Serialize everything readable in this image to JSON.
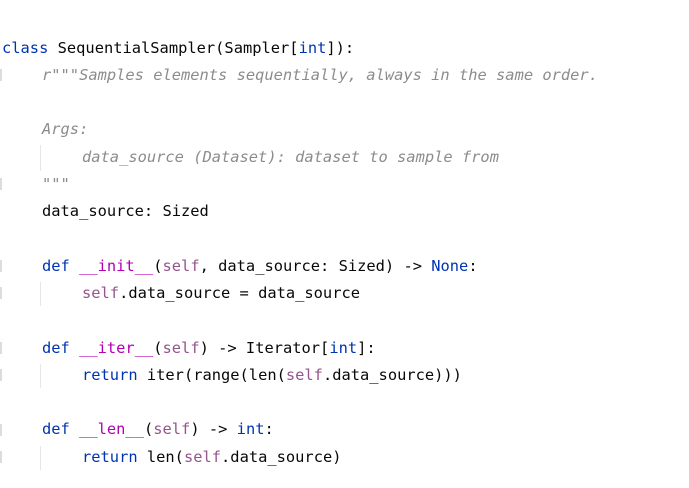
{
  "code": {
    "class_kw": "class",
    "class_name": "SequentialSampler",
    "class_base_open": "(Sampler[",
    "class_base_type": "int",
    "class_base_close": "]):",
    "docstring_line1": "r\"\"\"Samples elements sequentially, always in the same order.",
    "docstring_args": "Args:",
    "docstring_param": "data_source (Dataset): dataset to sample from",
    "docstring_close": "\"\"\"",
    "attr_line": "data_source: Sized",
    "init_def_kw": "def",
    "init_name": "__init__",
    "init_open": "(",
    "init_self": "self",
    "init_params": ", data_source: Sized) -> ",
    "init_ret": "None",
    "init_colon": ":",
    "init_body_self": "self",
    "init_body_rest": ".data_source = data_source",
    "iter_def_kw": "def",
    "iter_name": "__iter__",
    "iter_open": "(",
    "iter_self": "self",
    "iter_rest": ") -> Iterator[",
    "iter_ret": "int",
    "iter_close": "]:",
    "iter_body_kw": "return",
    "iter_body_pre": " iter(range(len(",
    "iter_body_self": "self",
    "iter_body_post": ".data_source)))",
    "len_def_kw": "def",
    "len_name": "__len__",
    "len_open": "(",
    "len_self": "self",
    "len_rest": ") -> ",
    "len_ret": "int",
    "len_colon": ":",
    "len_body_kw": "return",
    "len_body_pre": " len(",
    "len_body_self": "self",
    "len_body_post": ".data_source)"
  },
  "colors": {
    "keyword": "#0033b3",
    "dunder": "#b200b2",
    "self": "#94558d",
    "docstring": "#8c8c8c",
    "text": "#080808"
  }
}
